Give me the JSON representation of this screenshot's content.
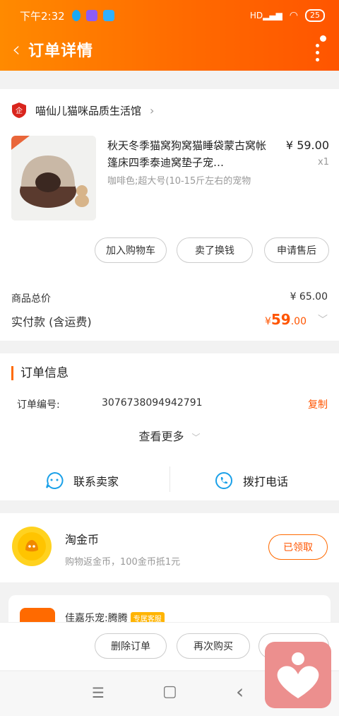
{
  "status": {
    "time": "下午2:32",
    "battery": "25"
  },
  "nav": {
    "title": "订单详情"
  },
  "store": {
    "name": "喵仙儿猫咪品质生活馆"
  },
  "product": {
    "title": "秋天冬季猫窝狗窝猫睡袋蒙古窝帐篷床四季泰迪窝垫子宠…",
    "sku": "咖啡色;超大号(10-15斤左右的宠物",
    "price": "¥ 59.00",
    "qty": "x1"
  },
  "actions": {
    "add_cart": "加入购物车",
    "resell": "卖了换钱",
    "after_sale": "申请售后"
  },
  "totals": {
    "goods_label": "商品总价",
    "goods_value": "¥ 65.00",
    "paid_label": "实付款 (含运费)",
    "paid_currency": "¥",
    "paid_int": "59",
    "paid_dec": ".00"
  },
  "order_info": {
    "title": "订单信息",
    "order_no_label": "订单编号:",
    "order_no": "3076738094942791",
    "copy": "复制",
    "see_more": "查看更多"
  },
  "contact": {
    "seller": "联系卖家",
    "phone": "拨打电话"
  },
  "coins": {
    "title": "淘金币",
    "subtitle": "购物返金币，100金币抵1元",
    "button": "已领取"
  },
  "store_card": {
    "name": "佳嘉乐宠:腾腾",
    "tag": "专属客服"
  },
  "bottom": {
    "delete": "删除订单",
    "rebuy": "再次购买"
  },
  "sysnav": {
    "menu": "☰",
    "home": "▢",
    "back": "‹"
  },
  "colors": {
    "accent": "#ff5500",
    "header_start": "#ff8a00",
    "header_end": "#ff5500"
  }
}
